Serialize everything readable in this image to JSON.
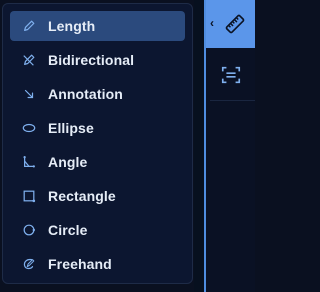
{
  "menu": {
    "items": [
      {
        "label": "Length",
        "icon": "pencil-icon",
        "active": true
      },
      {
        "label": "Bidirectional",
        "icon": "bidirectional-icon",
        "active": false
      },
      {
        "label": "Annotation",
        "icon": "arrow-down-right-icon",
        "active": false
      },
      {
        "label": "Ellipse",
        "icon": "ellipse-icon",
        "active": false
      },
      {
        "label": "Angle",
        "icon": "angle-icon",
        "active": false
      },
      {
        "label": "Rectangle",
        "icon": "rectangle-icon",
        "active": false
      },
      {
        "label": "Circle",
        "icon": "circle-icon",
        "active": false
      },
      {
        "label": "Freehand",
        "icon": "freehand-icon",
        "active": false
      }
    ]
  },
  "toolbar": {
    "chevron": "‹",
    "buttons": [
      {
        "icon": "ruler-icon",
        "active": true
      },
      {
        "icon": "scan-text-icon",
        "active": false
      }
    ]
  },
  "colors": {
    "active_item": "#2b4a7d",
    "accent": "#5b96ea",
    "icon": "#7fb0ee"
  }
}
